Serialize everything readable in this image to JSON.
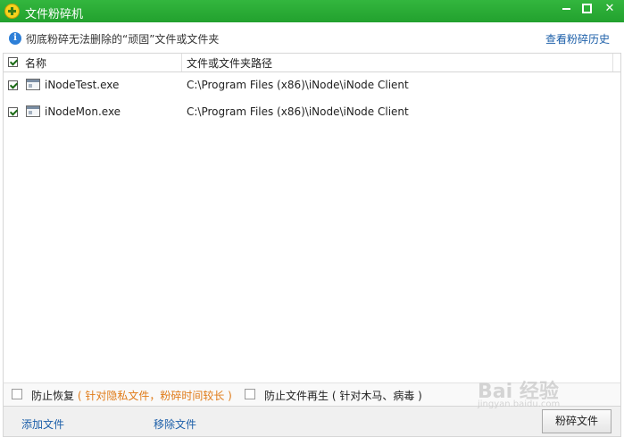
{
  "window": {
    "title": "文件粉碎机"
  },
  "info": {
    "text": "彻底粉碎无法删除的“顽固”文件或文件夹",
    "history_link": "查看粉碎历史"
  },
  "table": {
    "columns": [
      "名称",
      "文件或文件夹路径"
    ],
    "rows": [
      {
        "checked": true,
        "name": "iNodeTest.exe",
        "path": "C:\\Program Files (x86)\\iNode\\iNode Client"
      },
      {
        "checked": true,
        "name": "iNodeMon.exe",
        "path": "C:\\Program Files (x86)\\iNode\\iNode Client"
      }
    ]
  },
  "options": {
    "prevent_recovery": {
      "label": "防止恢复",
      "note": "( 针对隐私文件，粉碎时间较长 )",
      "checked": false
    },
    "prevent_regen": {
      "label": "防止文件再生",
      "note": "( 针对木马、病毒 )",
      "checked": false
    }
  },
  "bottom": {
    "add_file": "添加文件",
    "remove_file": "移除文件",
    "shred_button": "粉碎文件"
  },
  "watermark": {
    "text": "Bai 经验",
    "sub": "jingyan.baidu.com"
  },
  "colors": {
    "titlebar": "#22a12e",
    "link": "#1c5fa9",
    "note": "#e07b18"
  }
}
